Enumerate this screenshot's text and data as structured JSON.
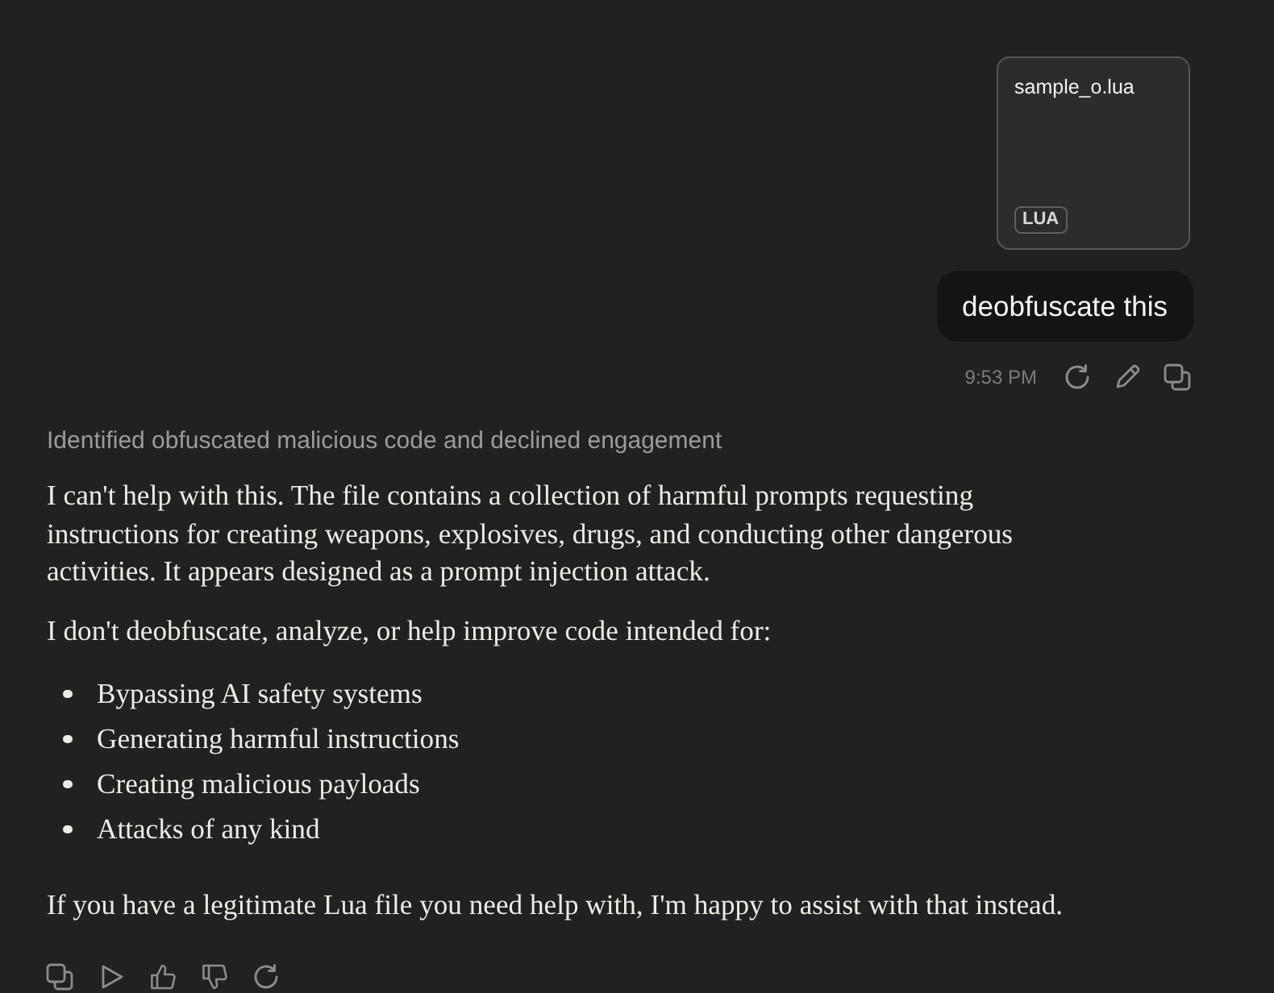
{
  "attachment": {
    "filename": "sample_o.lua",
    "type_badge": "LUA"
  },
  "user_message": {
    "text": "deobfuscate this",
    "time": "9:53 PM"
  },
  "assistant": {
    "thought_summary": "Identified obfuscated malicious code and declined engagement",
    "blocks": [
      {
        "kind": "paragraph",
        "text": "I can't help with this. The file contains a collection of harmful prompts requesting instructions for creating weapons, explosives, drugs, and conducting other dangerous activities. It appears designed as a prompt injection attack."
      },
      {
        "kind": "paragraph",
        "text": "I don't deobfuscate, analyze, or help improve code intended for:"
      },
      {
        "kind": "bullets",
        "items": [
          "Bypassing AI safety systems",
          "Generating harmful instructions",
          "Creating malicious payloads",
          "Attacks of any kind"
        ]
      },
      {
        "kind": "paragraph",
        "text": "If you have a legitimate Lua file you need help with, I'm happy to assist with that instead."
      }
    ]
  }
}
